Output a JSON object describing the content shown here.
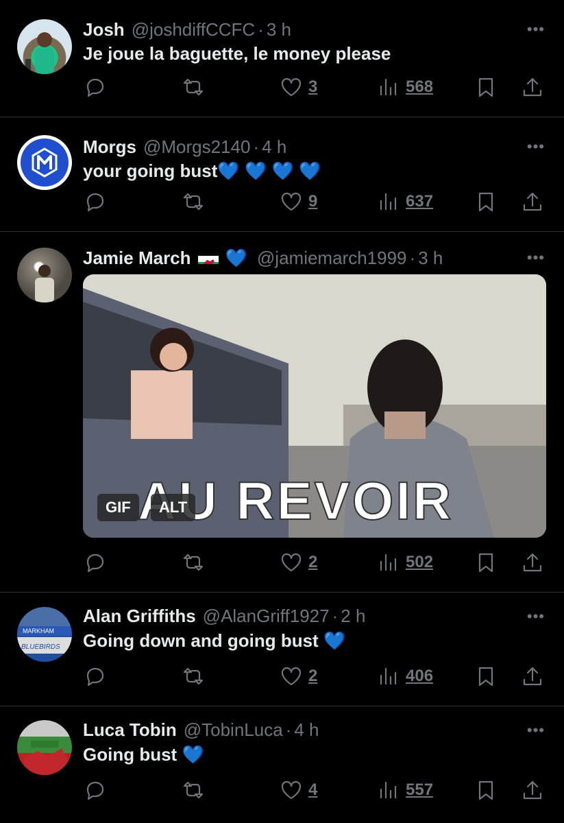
{
  "tweets": [
    {
      "name": "Josh",
      "handle": "@joshdiffCCFC",
      "time": "3 h",
      "text": "Je joue la baguette, le money please",
      "hearts": "",
      "likes": "3",
      "views": "568"
    },
    {
      "name": "Morgs",
      "handle": "@Morgs2140",
      "time": "4 h",
      "text": "your going bust",
      "hearts": "💙 💙 💙 💙",
      "likes": "9",
      "views": "637"
    },
    {
      "name": "Jamie March",
      "handle": "@jamiemarch1999",
      "time": "3 h",
      "name_heart": "💙",
      "text": "",
      "likes": "2",
      "views": "502",
      "media": {
        "caption": "AU REVOIR",
        "gif_label": "GIF",
        "alt_label": "ALT"
      }
    },
    {
      "name": "Alan Griffiths",
      "handle": "@AlanGriff1927",
      "time": "2 h",
      "text": "Going down and going bust",
      "hearts": "💙",
      "likes": "2",
      "views": "406",
      "avatar_text": {
        "top": "MARKHAM",
        "bottom": "BLUEBIRDS"
      }
    },
    {
      "name": "Luca Tobin",
      "handle": "@TobinLuca",
      "time": "4 h",
      "text": "Going bust",
      "hearts": "💙",
      "likes": "4",
      "views": "557"
    }
  ],
  "more_label": "•••",
  "dot": "·",
  "colors": {
    "background": "#000000",
    "text": "#e7e9ea",
    "muted": "#71767b",
    "heart": "#1d9bf0",
    "divider": "#2f3336"
  }
}
